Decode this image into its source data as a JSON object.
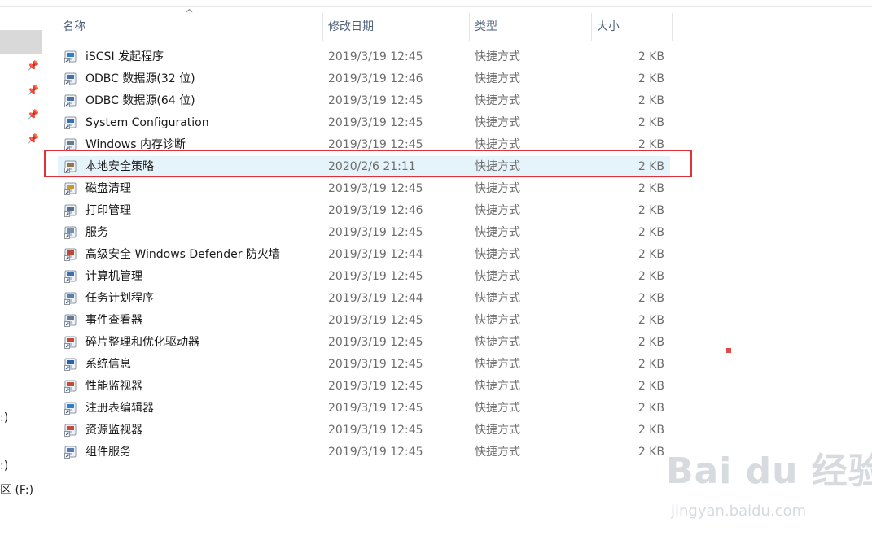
{
  "columns": {
    "name": "名称",
    "date": "修改日期",
    "type": "类型",
    "size": "大小"
  },
  "nav_drives": [
    ":)",
    ":)",
    "区 (F:)"
  ],
  "files": [
    {
      "name": "iSCSI 发起程序",
      "date": "2019/3/19 12:45",
      "type": "快捷方式",
      "size": "2 KB",
      "icon": "iscsi-icon",
      "color": "#2f7fcf"
    },
    {
      "name": "ODBC 数据源(32 位)",
      "date": "2019/3/19 12:46",
      "type": "快捷方式",
      "size": "2 KB",
      "icon": "odbc-icon",
      "color": "#4a6fa5"
    },
    {
      "name": "ODBC 数据源(64 位)",
      "date": "2019/3/19 12:45",
      "type": "快捷方式",
      "size": "2 KB",
      "icon": "odbc-icon",
      "color": "#4a6fa5"
    },
    {
      "name": "System Configuration",
      "date": "2019/3/19 12:45",
      "type": "快捷方式",
      "size": "2 KB",
      "icon": "system-config-icon",
      "color": "#3b6fb6"
    },
    {
      "name": "Windows 内存诊断",
      "date": "2019/3/19 12:45",
      "type": "快捷方式",
      "size": "2 KB",
      "icon": "memory-diagnostic-icon",
      "color": "#6b7a8a"
    },
    {
      "name": "本地安全策略",
      "date": "2020/2/6 21:11",
      "type": "快捷方式",
      "size": "2 KB",
      "icon": "security-policy-icon",
      "color": "#8a7a4a"
    },
    {
      "name": "磁盘清理",
      "date": "2019/3/19 12:45",
      "type": "快捷方式",
      "size": "2 KB",
      "icon": "disk-cleanup-icon",
      "color": "#c79a2e"
    },
    {
      "name": "打印管理",
      "date": "2019/3/19 12:46",
      "type": "快捷方式",
      "size": "2 KB",
      "icon": "print-management-icon",
      "color": "#5a6e86"
    },
    {
      "name": "服务",
      "date": "2019/3/19 12:45",
      "type": "快捷方式",
      "size": "2 KB",
      "icon": "services-icon",
      "color": "#7a8fa8"
    },
    {
      "name": "高级安全 Windows Defender 防火墙",
      "date": "2019/3/19 12:44",
      "type": "快捷方式",
      "size": "2 KB",
      "icon": "firewall-icon",
      "color": "#b84a3a"
    },
    {
      "name": "计算机管理",
      "date": "2019/3/19 12:45",
      "type": "快捷方式",
      "size": "2 KB",
      "icon": "computer-management-icon",
      "color": "#3f6fb0"
    },
    {
      "name": "任务计划程序",
      "date": "2019/3/19 12:44",
      "type": "快捷方式",
      "size": "2 KB",
      "icon": "task-scheduler-icon",
      "color": "#5b7fa8"
    },
    {
      "name": "事件查看器",
      "date": "2019/3/19 12:45",
      "type": "快捷方式",
      "size": "2 KB",
      "icon": "event-viewer-icon",
      "color": "#6a7a8e"
    },
    {
      "name": "碎片整理和优化驱动器",
      "date": "2019/3/19 12:45",
      "type": "快捷方式",
      "size": "2 KB",
      "icon": "defrag-icon",
      "color": "#c4483a"
    },
    {
      "name": "系统信息",
      "date": "2019/3/19 12:45",
      "type": "快捷方式",
      "size": "2 KB",
      "icon": "system-info-icon",
      "color": "#2f5fa8"
    },
    {
      "name": "性能监视器",
      "date": "2019/3/19 12:45",
      "type": "快捷方式",
      "size": "2 KB",
      "icon": "performance-monitor-icon",
      "color": "#c44a3a"
    },
    {
      "name": "注册表编辑器",
      "date": "2019/3/19 12:45",
      "type": "快捷方式",
      "size": "2 KB",
      "icon": "registry-editor-icon",
      "color": "#2f7fcf"
    },
    {
      "name": "资源监视器",
      "date": "2019/3/19 12:45",
      "type": "快捷方式",
      "size": "2 KB",
      "icon": "resource-monitor-icon",
      "color": "#c44a3a"
    },
    {
      "name": "组件服务",
      "date": "2019/3/19 12:45",
      "type": "快捷方式",
      "size": "2 KB",
      "icon": "component-services-icon",
      "color": "#5a7ab0"
    }
  ],
  "highlighted_index": 5,
  "accent": {
    "highlight_box": "#e0303a",
    "selection_bg": "#e5f3fb"
  },
  "watermark": {
    "logo": "Bai du 经验",
    "url": "jingyan.baidu.com"
  }
}
